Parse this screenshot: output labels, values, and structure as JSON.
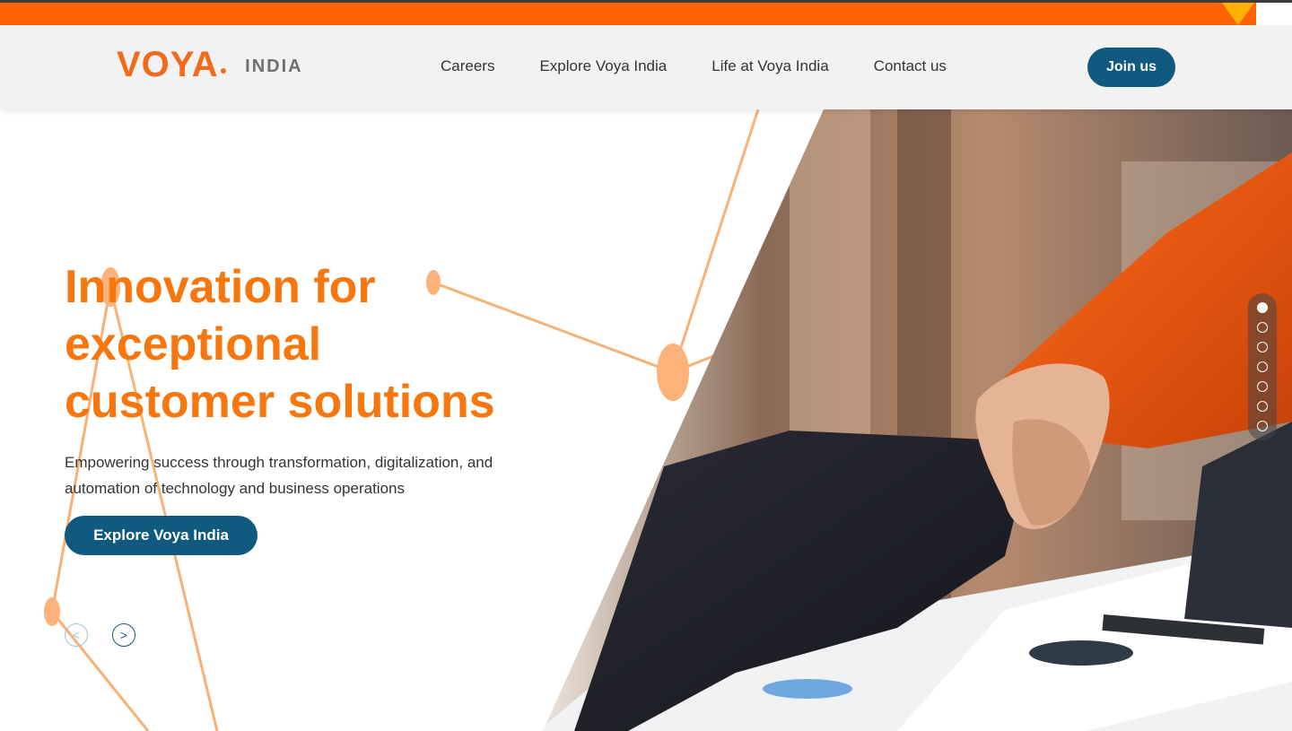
{
  "brand": {
    "logo_text": "VOYA",
    "logo_sub": "INDIA",
    "orange": "#f26b1d",
    "navy": "#0f5a7e"
  },
  "nav": {
    "items": [
      "Careers",
      "Explore Voya India",
      "Life at Voya India",
      "Contact us"
    ],
    "join_label": "Join us"
  },
  "hero": {
    "headline_lines": [
      "Innovation for",
      "exceptional",
      "customer solutions"
    ],
    "subtitle": "Empowering success through transformation, digitalization, and automation of technology and business operations",
    "cta_label": "Explore Voya India",
    "prev_icon": "chevron-left-icon",
    "next_icon": "chevron-right-icon",
    "slide_count": 7,
    "active_slide": 1,
    "image": "handshake-photo"
  }
}
